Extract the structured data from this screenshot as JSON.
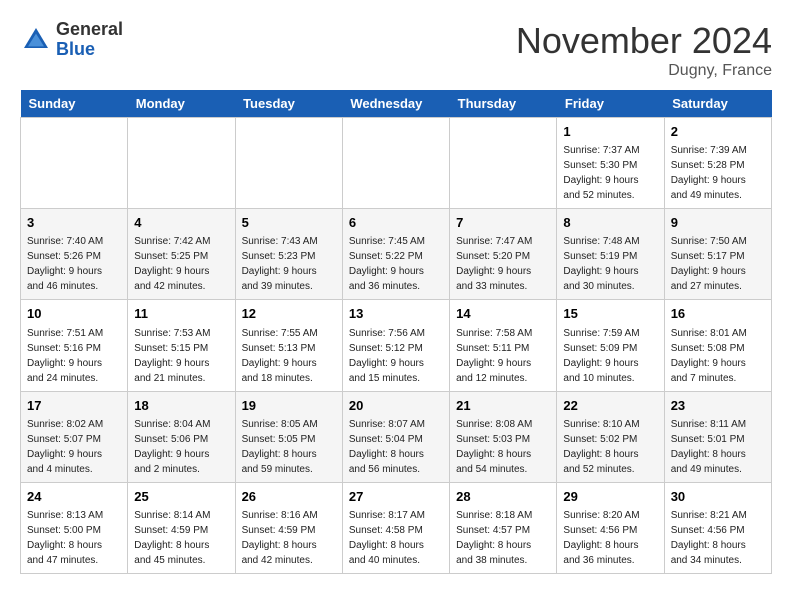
{
  "header": {
    "logo_general": "General",
    "logo_blue": "Blue",
    "month_title": "November 2024",
    "location": "Dugny, France"
  },
  "weekdays": [
    "Sunday",
    "Monday",
    "Tuesday",
    "Wednesday",
    "Thursday",
    "Friday",
    "Saturday"
  ],
  "weeks": [
    [
      {
        "day": "",
        "info": ""
      },
      {
        "day": "",
        "info": ""
      },
      {
        "day": "",
        "info": ""
      },
      {
        "day": "",
        "info": ""
      },
      {
        "day": "",
        "info": ""
      },
      {
        "day": "1",
        "info": "Sunrise: 7:37 AM\nSunset: 5:30 PM\nDaylight: 9 hours\nand 52 minutes."
      },
      {
        "day": "2",
        "info": "Sunrise: 7:39 AM\nSunset: 5:28 PM\nDaylight: 9 hours\nand 49 minutes."
      }
    ],
    [
      {
        "day": "3",
        "info": "Sunrise: 7:40 AM\nSunset: 5:26 PM\nDaylight: 9 hours\nand 46 minutes."
      },
      {
        "day": "4",
        "info": "Sunrise: 7:42 AM\nSunset: 5:25 PM\nDaylight: 9 hours\nand 42 minutes."
      },
      {
        "day": "5",
        "info": "Sunrise: 7:43 AM\nSunset: 5:23 PM\nDaylight: 9 hours\nand 39 minutes."
      },
      {
        "day": "6",
        "info": "Sunrise: 7:45 AM\nSunset: 5:22 PM\nDaylight: 9 hours\nand 36 minutes."
      },
      {
        "day": "7",
        "info": "Sunrise: 7:47 AM\nSunset: 5:20 PM\nDaylight: 9 hours\nand 33 minutes."
      },
      {
        "day": "8",
        "info": "Sunrise: 7:48 AM\nSunset: 5:19 PM\nDaylight: 9 hours\nand 30 minutes."
      },
      {
        "day": "9",
        "info": "Sunrise: 7:50 AM\nSunset: 5:17 PM\nDaylight: 9 hours\nand 27 minutes."
      }
    ],
    [
      {
        "day": "10",
        "info": "Sunrise: 7:51 AM\nSunset: 5:16 PM\nDaylight: 9 hours\nand 24 minutes."
      },
      {
        "day": "11",
        "info": "Sunrise: 7:53 AM\nSunset: 5:15 PM\nDaylight: 9 hours\nand 21 minutes."
      },
      {
        "day": "12",
        "info": "Sunrise: 7:55 AM\nSunset: 5:13 PM\nDaylight: 9 hours\nand 18 minutes."
      },
      {
        "day": "13",
        "info": "Sunrise: 7:56 AM\nSunset: 5:12 PM\nDaylight: 9 hours\nand 15 minutes."
      },
      {
        "day": "14",
        "info": "Sunrise: 7:58 AM\nSunset: 5:11 PM\nDaylight: 9 hours\nand 12 minutes."
      },
      {
        "day": "15",
        "info": "Sunrise: 7:59 AM\nSunset: 5:09 PM\nDaylight: 9 hours\nand 10 minutes."
      },
      {
        "day": "16",
        "info": "Sunrise: 8:01 AM\nSunset: 5:08 PM\nDaylight: 9 hours\nand 7 minutes."
      }
    ],
    [
      {
        "day": "17",
        "info": "Sunrise: 8:02 AM\nSunset: 5:07 PM\nDaylight: 9 hours\nand 4 minutes."
      },
      {
        "day": "18",
        "info": "Sunrise: 8:04 AM\nSunset: 5:06 PM\nDaylight: 9 hours\nand 2 minutes."
      },
      {
        "day": "19",
        "info": "Sunrise: 8:05 AM\nSunset: 5:05 PM\nDaylight: 8 hours\nand 59 minutes."
      },
      {
        "day": "20",
        "info": "Sunrise: 8:07 AM\nSunset: 5:04 PM\nDaylight: 8 hours\nand 56 minutes."
      },
      {
        "day": "21",
        "info": "Sunrise: 8:08 AM\nSunset: 5:03 PM\nDaylight: 8 hours\nand 54 minutes."
      },
      {
        "day": "22",
        "info": "Sunrise: 8:10 AM\nSunset: 5:02 PM\nDaylight: 8 hours\nand 52 minutes."
      },
      {
        "day": "23",
        "info": "Sunrise: 8:11 AM\nSunset: 5:01 PM\nDaylight: 8 hours\nand 49 minutes."
      }
    ],
    [
      {
        "day": "24",
        "info": "Sunrise: 8:13 AM\nSunset: 5:00 PM\nDaylight: 8 hours\nand 47 minutes."
      },
      {
        "day": "25",
        "info": "Sunrise: 8:14 AM\nSunset: 4:59 PM\nDaylight: 8 hours\nand 45 minutes."
      },
      {
        "day": "26",
        "info": "Sunrise: 8:16 AM\nSunset: 4:59 PM\nDaylight: 8 hours\nand 42 minutes."
      },
      {
        "day": "27",
        "info": "Sunrise: 8:17 AM\nSunset: 4:58 PM\nDaylight: 8 hours\nand 40 minutes."
      },
      {
        "day": "28",
        "info": "Sunrise: 8:18 AM\nSunset: 4:57 PM\nDaylight: 8 hours\nand 38 minutes."
      },
      {
        "day": "29",
        "info": "Sunrise: 8:20 AM\nSunset: 4:56 PM\nDaylight: 8 hours\nand 36 minutes."
      },
      {
        "day": "30",
        "info": "Sunrise: 8:21 AM\nSunset: 4:56 PM\nDaylight: 8 hours\nand 34 minutes."
      }
    ]
  ]
}
